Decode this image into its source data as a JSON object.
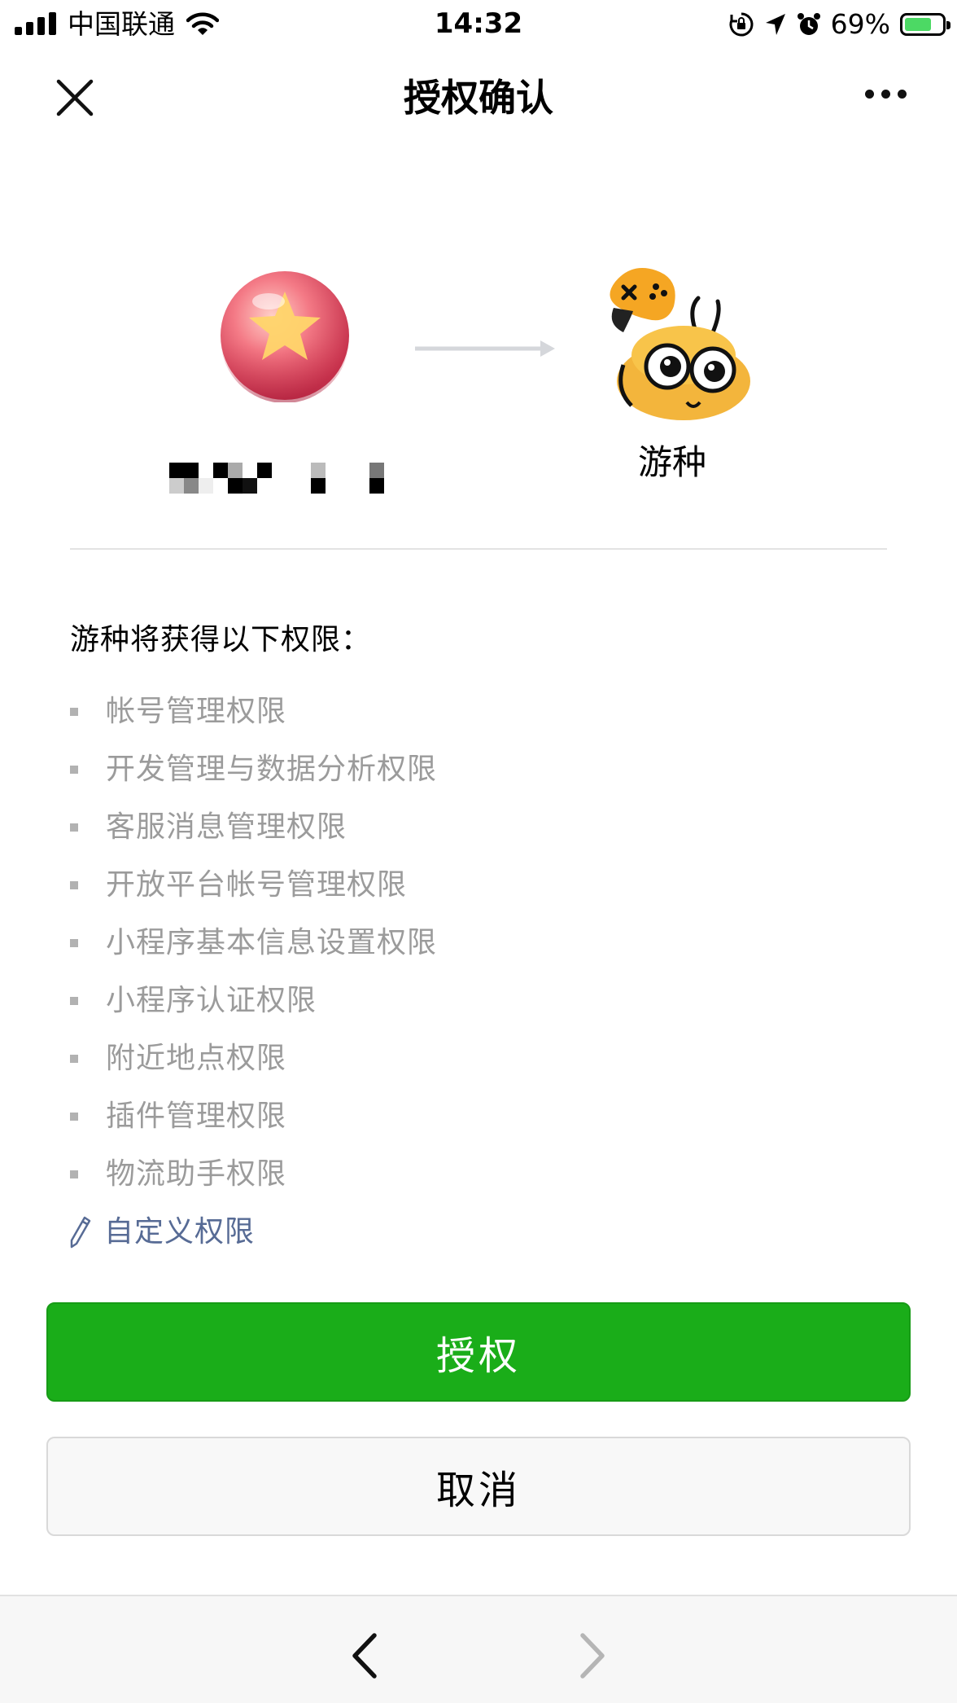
{
  "status_bar": {
    "carrier": "中国联通",
    "time": "14:32",
    "battery": "69%",
    "battery_level": 0.69,
    "icons": [
      "signal-icon",
      "wifi-icon",
      "orientation-lock-icon",
      "location-icon",
      "alarm-icon",
      "battery-icon"
    ]
  },
  "nav": {
    "title": "授权确认",
    "icons": [
      "close-icon",
      "more-icon"
    ]
  },
  "header": {
    "app_name": "游种",
    "user_name_redacted": true
  },
  "permissions": {
    "heading": "游种将获得以下权限：",
    "items": [
      "帐号管理权限",
      "开发管理与数据分析权限",
      "客服消息管理权限",
      "开放平台帐号管理权限",
      "小程序基本信息设置权限",
      "小程序认证权限",
      "附近地点权限",
      "插件管理权限",
      "物流助手权限"
    ],
    "custom_label": "自定义权限"
  },
  "buttons": {
    "authorize": "授权",
    "cancel": "取消"
  },
  "toolbar": {
    "icons": [
      "back-icon",
      "forward-icon"
    ]
  },
  "colors": {
    "primary_green": "#1aad19",
    "link_blue": "#576b95",
    "muted_text": "#9b9b9b"
  }
}
